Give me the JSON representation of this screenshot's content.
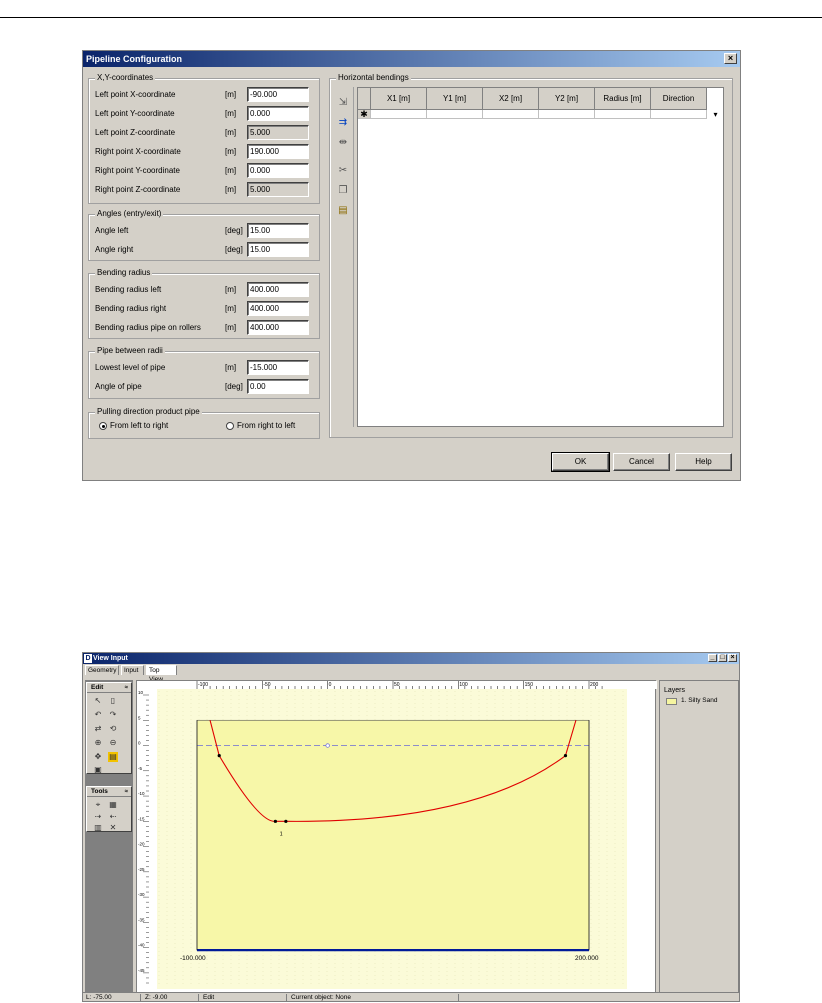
{
  "dialog": {
    "title": "Pipeline Configuration",
    "close_glyph": "×",
    "xy_group": {
      "title": "X,Y-coordinates",
      "rows": [
        {
          "label": "Left point X-coordinate",
          "unit": "[m]",
          "value": "-90.000",
          "readonly": false
        },
        {
          "label": "Left point Y-coordinate",
          "unit": "[m]",
          "value": "0.000",
          "readonly": false
        },
        {
          "label": "Left point Z-coordinate",
          "unit": "[m]",
          "value": "5.000",
          "readonly": true
        },
        {
          "label": "Right point X-coordinate",
          "unit": "[m]",
          "value": "190.000",
          "readonly": false
        },
        {
          "label": "Right point Y-coordinate",
          "unit": "[m]",
          "value": "0.000",
          "readonly": false
        },
        {
          "label": "Right point Z-coordinate",
          "unit": "[m]",
          "value": "5.000",
          "readonly": true
        }
      ]
    },
    "angles_group": {
      "title": "Angles (entry/exit)",
      "rows": [
        {
          "label": "Angle left",
          "unit": "[deg]",
          "value": "15.00"
        },
        {
          "label": "Angle right",
          "unit": "[deg]",
          "value": "15.00"
        }
      ]
    },
    "bending_group": {
      "title": "Bending radius",
      "rows": [
        {
          "label": "Bending radius left",
          "unit": "[m]",
          "value": "400.000"
        },
        {
          "label": "Bending radius right",
          "unit": "[m]",
          "value": "400.000"
        },
        {
          "label": "Bending radius pipe on rollers",
          "unit": "[m]",
          "value": "400.000"
        }
      ]
    },
    "pipe_group": {
      "title": "Pipe between radii",
      "rows": [
        {
          "label": "Lowest level of pipe",
          "unit": "[m]",
          "value": "-15.000"
        },
        {
          "label": "Angle of pipe",
          "unit": "[deg]",
          "value": "0.00"
        }
      ]
    },
    "pulling_group": {
      "title": "Pulling direction product pipe",
      "option_left": "From left to right",
      "option_right": "From right to left",
      "selected": "left"
    },
    "horizontal_group": {
      "title": "Horizontal bendings",
      "columns": [
        "X1 [m]",
        "Y1 [m]",
        "X2 [m]",
        "Y2 [m]",
        "Radius [m]",
        "Direction"
      ],
      "new_row_marker": "✱",
      "dropdown_glyph": "▾",
      "tools": [
        "insert-row-icon",
        "add-row-icon",
        "delete-row-icon",
        "cut-icon",
        "copy-icon",
        "paste-icon"
      ]
    },
    "buttons": {
      "ok": "OK",
      "cancel": "Cancel",
      "help": "Help"
    }
  },
  "view": {
    "title": "View Input",
    "app_icon": "D",
    "window_buttons": {
      "minimize": "_",
      "maximize": "□",
      "close": "×"
    },
    "tabs": [
      "Geometry",
      "Input",
      "Top View"
    ],
    "active_tab": "Top View",
    "edit_panel": {
      "title": "Edit",
      "caret": "≈"
    },
    "tools_panel": {
      "title": "Tools",
      "caret": "≈"
    },
    "layers_title": "Layers",
    "layers": [
      {
        "name": "1. Silty Sand",
        "color": "#f5f5a0"
      }
    ],
    "x_ticks": [
      "-100",
      "-50",
      "0",
      "50",
      "100",
      "150",
      "200"
    ],
    "y_ticks": [
      "10",
      "5",
      "0",
      "-5",
      "-10",
      "-15",
      "-20",
      "-25",
      "-30",
      "-35",
      "-40",
      "-45"
    ],
    "left_label": "-100.000",
    "right_label": "200.000",
    "point_label": "1",
    "profile": {
      "x_range": [
        -100,
        200
      ],
      "y_range": [
        -47,
        10
      ],
      "surface_level": 5,
      "bottom_level": -40.5,
      "water_level": 0,
      "pipe_points": [
        [
          -90,
          5
        ],
        [
          -83,
          -2
        ],
        [
          -40,
          -15
        ],
        [
          -32,
          -15
        ],
        [
          182,
          -2
        ],
        [
          190,
          5
        ]
      ]
    },
    "colors": {
      "soil": "#f7f7a8",
      "pipe": "#e00000",
      "bottom": "#001a99",
      "water": "#6b6bd6"
    },
    "status": {
      "l_value": "L: -75.00",
      "z_value": "Z: -9.00",
      "mode": "Edit",
      "current": "Current object: None"
    }
  }
}
